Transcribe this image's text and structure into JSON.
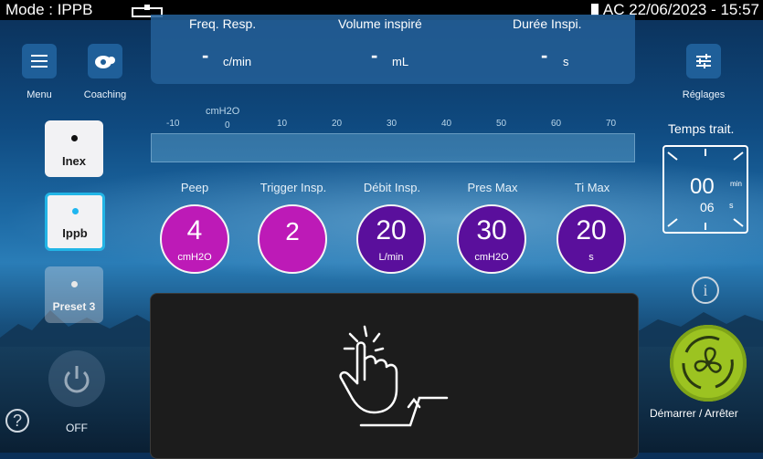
{
  "status": {
    "mode": "Mode : IPPB",
    "power": "AC",
    "datetime": "22/06/2023 - 15:57"
  },
  "left_panel": {
    "menu_label": "Menu",
    "coaching_label": "Coaching",
    "presets": [
      {
        "label": "Inex",
        "state": "normal"
      },
      {
        "label": "Ippb",
        "state": "selected"
      },
      {
        "label": "Preset 3",
        "state": "disabled"
      }
    ],
    "power_label": "OFF"
  },
  "measurements": [
    {
      "label": "Freq. Resp.",
      "value": "-",
      "unit": "c/min"
    },
    {
      "label": "Volume inspiré",
      "value": "-",
      "unit": "mL"
    },
    {
      "label": "Durée Inspi.",
      "value": "-",
      "unit": "s"
    }
  ],
  "gauge": {
    "unit": "cmH2O",
    "ticks": [
      "-10",
      "0",
      "10",
      "20",
      "30",
      "40",
      "50",
      "60",
      "70"
    ]
  },
  "parameters": [
    {
      "label": "Peep",
      "value": "4",
      "unit": "cmH2O"
    },
    {
      "label": "Trigger Insp.",
      "value": "2",
      "unit": ""
    },
    {
      "label": "Débit Insp.",
      "value": "20",
      "unit": "L/min"
    },
    {
      "label": "Pres Max",
      "value": "30",
      "unit": "cmH2O"
    },
    {
      "label": "Ti Max",
      "value": "20",
      "unit": "s"
    }
  ],
  "right_panel": {
    "settings_label": "Réglages",
    "timer_title": "Temps trait.",
    "timer_minutes": "00",
    "timer_min_unit": "min",
    "timer_seconds": "06",
    "timer_sec_unit": "s",
    "start_stop_label": "Démarrer / Arrêter"
  },
  "colors": {
    "statusbar": "#000000",
    "param_magenta": "#bd1ab7",
    "param_purple": "#5a0f9c",
    "start_button": "#9cc321",
    "selected_preset_border": "#22b5e6"
  }
}
